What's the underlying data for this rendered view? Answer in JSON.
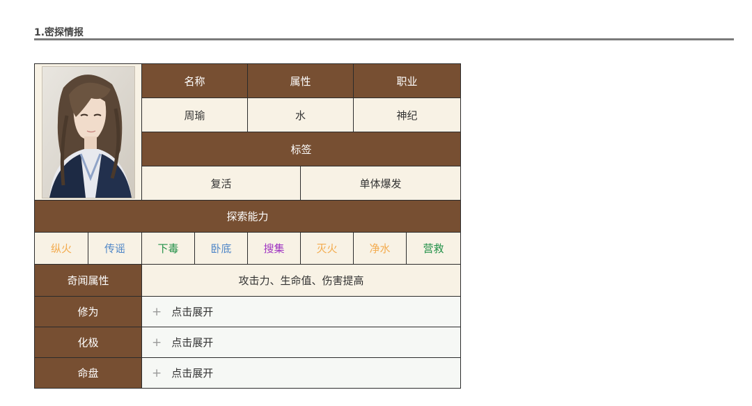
{
  "section": {
    "title": "1.密探情报"
  },
  "character": {
    "headers": {
      "name": "名称",
      "attribute": "属性",
      "profession": "职业"
    },
    "values": {
      "name": "周瑜",
      "attribute": "水",
      "profession": "神纪"
    },
    "tags_header": "标签",
    "tags": [
      "复活",
      "单体爆发"
    ]
  },
  "exploration": {
    "header": "探索能力",
    "abilities": [
      {
        "label": "纵火",
        "color": "#f3ab4e"
      },
      {
        "label": "传谣",
        "color": "#4f86c7"
      },
      {
        "label": "下毒",
        "color": "#1f8f46"
      },
      {
        "label": "卧底",
        "color": "#4f86c7"
      },
      {
        "label": "搜集",
        "color": "#a036c2"
      },
      {
        "label": "灭火",
        "color": "#f3ab4e"
      },
      {
        "label": "净水",
        "color": "#f3ab4e"
      },
      {
        "label": "营救",
        "color": "#1f8f46"
      }
    ]
  },
  "rumor": {
    "label": "奇闻属性",
    "value": "攻击力、生命值、伤害提高"
  },
  "expand_rows": [
    {
      "label": "修为",
      "plus": "+",
      "action": "点击展开"
    },
    {
      "label": "化极",
      "plus": "+",
      "action": "点击展开"
    },
    {
      "label": "命盘",
      "plus": "+",
      "action": "点击展开"
    }
  ],
  "colors": {
    "header_bg": "#774f32",
    "cell_bg": "#f8f2e5",
    "expand_bg": "#f6f8f5"
  }
}
